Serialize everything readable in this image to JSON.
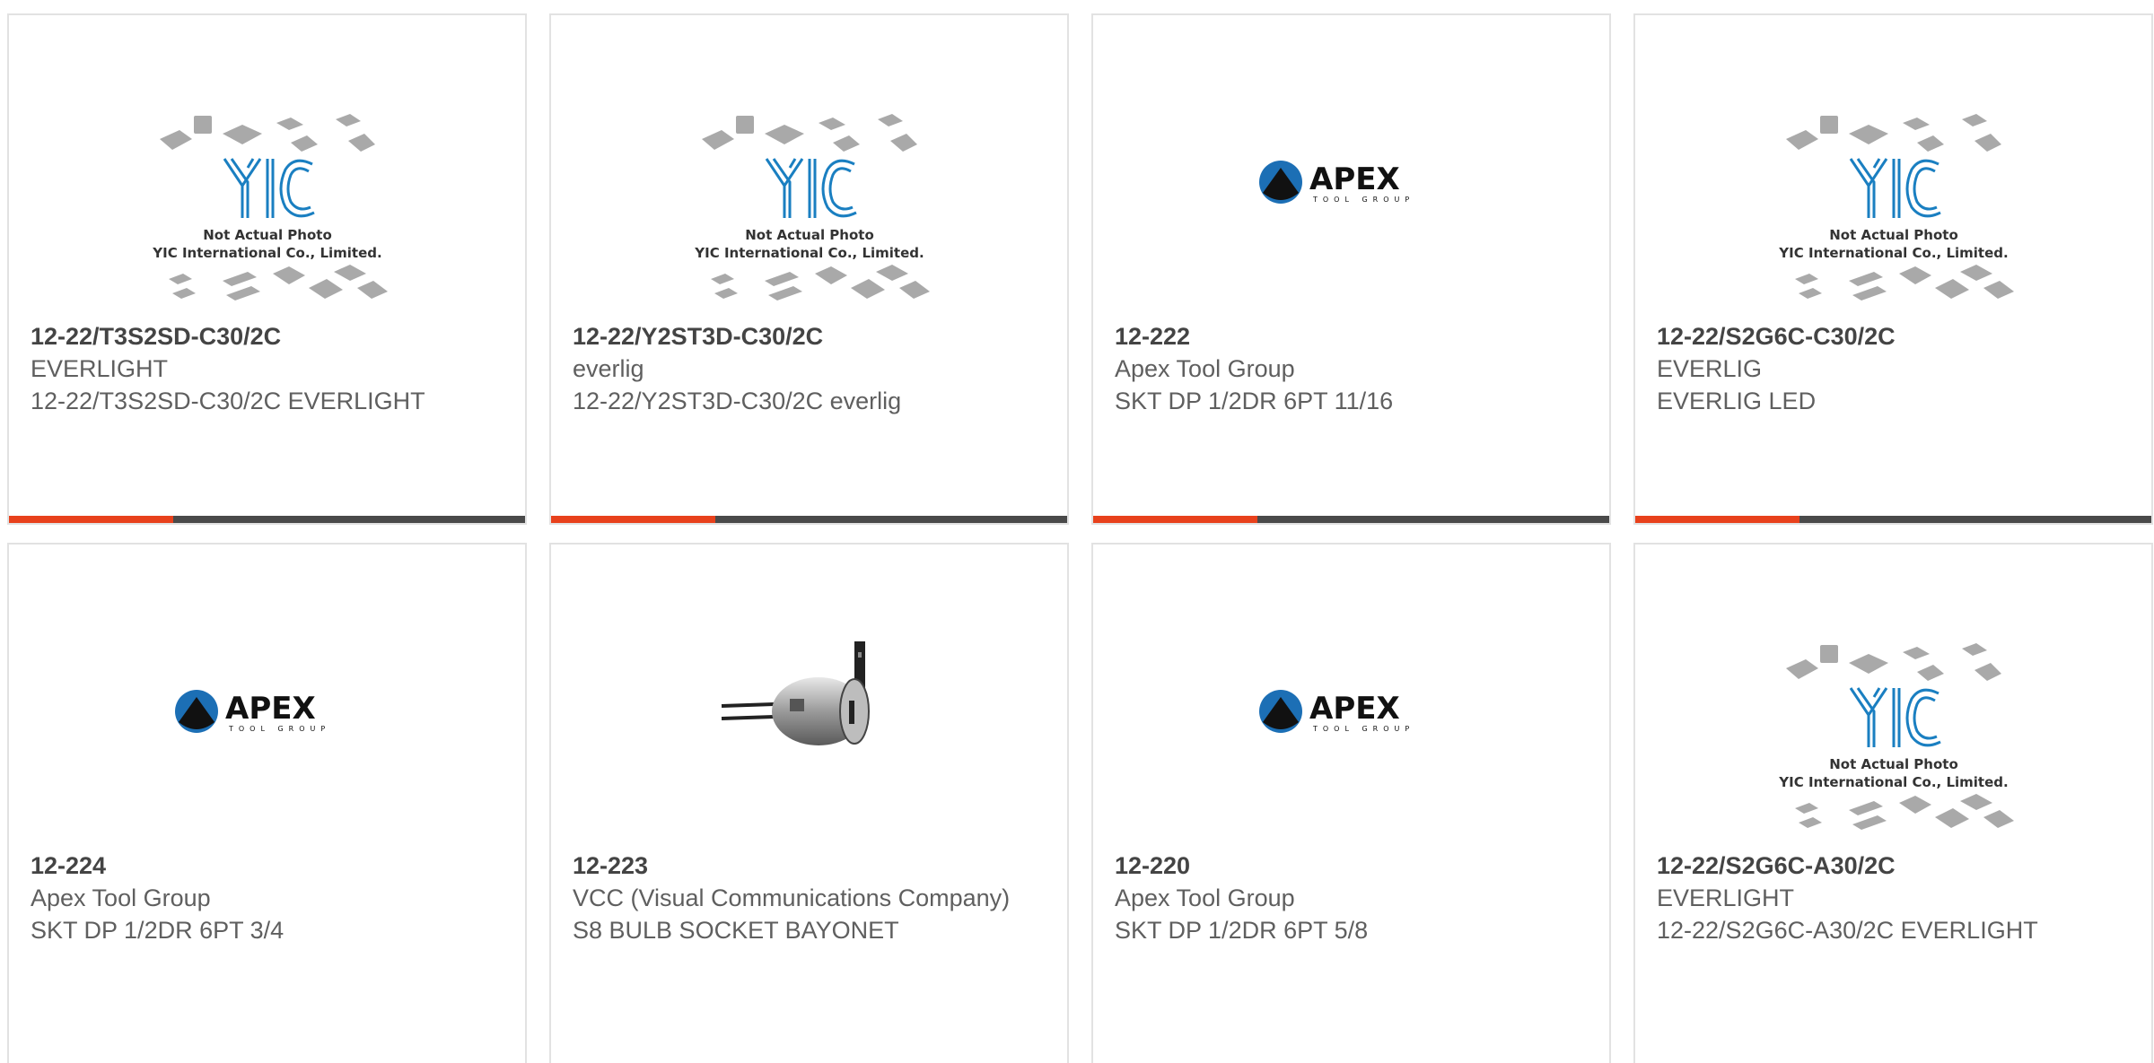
{
  "products": [
    {
      "part": "12-22/T3S2SD-C30/2C",
      "manufacturer": "EVERLIGHT",
      "description": "12-22/T3S2SD-C30/2C EVERLIGHT",
      "image": "yic-placeholder",
      "image_text": [
        "Not Actual Photo",
        "YIC International Co., Limited."
      ]
    },
    {
      "part": "12-22/Y2ST3D-C30/2C",
      "manufacturer": "everlig",
      "description": "12-22/Y2ST3D-C30/2C everlig",
      "image": "yic-placeholder",
      "image_text": [
        "Not Actual Photo",
        "YIC International Co., Limited."
      ]
    },
    {
      "part": "12-222",
      "manufacturer": "Apex Tool Group",
      "description": "SKT DP 1/2DR 6PT 11/16",
      "image": "apex-logo",
      "image_text": [
        "APEX",
        "TOOL GROUP"
      ]
    },
    {
      "part": "12-22/S2G6C-C30/2C",
      "manufacturer": "EVERLIG",
      "description": "EVERLIG LED",
      "image": "yic-placeholder",
      "image_text": [
        "Not Actual Photo",
        "YIC International Co., Limited."
      ]
    },
    {
      "part": "12-224",
      "manufacturer": "Apex Tool Group",
      "description": "SKT DP 1/2DR 6PT 3/4",
      "image": "apex-logo",
      "image_text": [
        "APEX",
        "TOOL GROUP"
      ]
    },
    {
      "part": "12-223",
      "manufacturer": "VCC (Visual Communications Company)",
      "description": "S8 BULB SOCKET BAYONET",
      "image": "bulb-socket-photo",
      "image_text": []
    },
    {
      "part": "12-220",
      "manufacturer": "Apex Tool Group",
      "description": "SKT DP 1/2DR 6PT 5/8",
      "image": "apex-logo",
      "image_text": [
        "APEX",
        "TOOL GROUP"
      ]
    },
    {
      "part": "12-22/S2G6C-A30/2C",
      "manufacturer": "EVERLIGHT",
      "description": "12-22/S2G6C-A30/2C EVERLIGHT",
      "image": "yic-placeholder",
      "image_text": [
        "Not Actual Photo",
        "YIC International Co., Limited."
      ]
    }
  ],
  "colors": {
    "accent": "#e8411c",
    "bar": "#4a4a4a",
    "border": "#e2e2e2",
    "yic_logo": "#1a7fc1",
    "apex_blue": "#1c6fb5"
  }
}
